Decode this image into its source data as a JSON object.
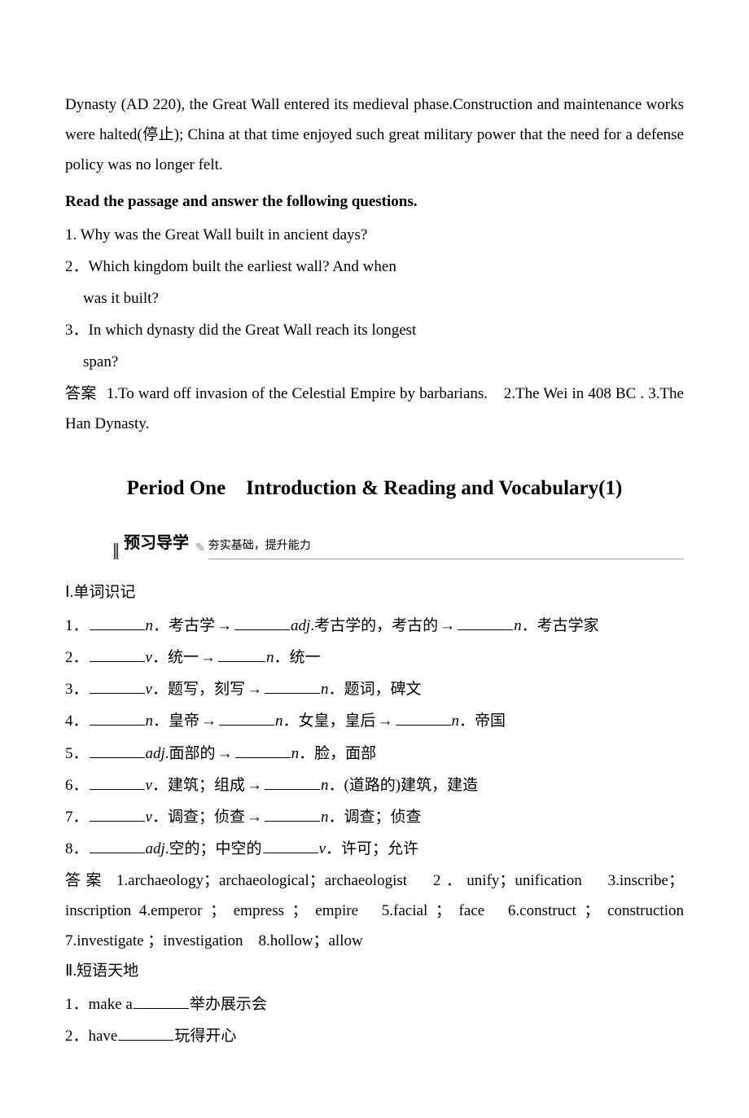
{
  "passage": "Dynasty (AD 220), the Great Wall entered its medieval phase.Construction and maintenance works were halted(停止); China at that time enjoyed such great military power that the need for a defense policy was no longer felt.",
  "questionHeader": "Read the passage and answer the following questions.",
  "questions": {
    "q1": "1. Why was the Great Wall built in ancient days?",
    "q2a": "2．Which kingdom built the earliest wall? And when",
    "q2b": "was it built?",
    "q3a": "3．In which dynasty did the Great Wall reach its longest",
    "q3b": "span?"
  },
  "answerLabel": "答案",
  "answerText": "1.To ward off invasion of the Celestial Empire by barbarians.　2.The Wei in 408 BC . 3.The Han Dynasty.",
  "periodTitle": "Period One　Introduction & Reading and Vocabulary(1)",
  "banner": {
    "main": "预习导学",
    "sub": "夯实基础，提升能力"
  },
  "section1Title": "Ⅰ.单词识记",
  "vocab": {
    "i1": {
      "lead": "1．",
      "p1": "n．考古学→",
      "p2": "adj.考古学的，考古的→",
      "p3": "n．考古学家"
    },
    "i2": {
      "lead": "2．",
      "p1": "v．统一→",
      "p2": "n．统一"
    },
    "i3": {
      "lead": "3．",
      "p1": "v．题写，刻写→",
      "p2": "n．题词，碑文"
    },
    "i4": {
      "lead": "4．",
      "p1": "n．皇帝→",
      "p2": "n．女皇，皇后→",
      "p3": "n．帝国"
    },
    "i5": {
      "lead": "5．",
      "p1": "adj.面部的→",
      "p2": "n．脸，面部"
    },
    "i6": {
      "lead": "6．",
      "p1": "v．建筑；组成→",
      "p2": "n．(道路的)建筑，建造"
    },
    "i7": {
      "lead": "7．",
      "p1": "v．调查；侦查→",
      "p2": "n．调查；侦查"
    },
    "i8": {
      "lead": "8．",
      "p1": "adj.空的；中空的",
      "p2": "v．许可；允许"
    }
  },
  "vocabAnswer": "1.archaeology；archaeological；archaeologist　2．unify；unification　3.inscribe；inscription 4.emperor ； empress ； empire　5.facial ； face　6.construct ； construction　7.investigate ；investigation　8.hollow；allow",
  "section2Title": "Ⅱ.短语天地",
  "phrases": {
    "p1": {
      "lead": "1．make a",
      "tail": "举办展示会"
    },
    "p2": {
      "lead": "2．have",
      "tail": "玩得开心"
    }
  }
}
